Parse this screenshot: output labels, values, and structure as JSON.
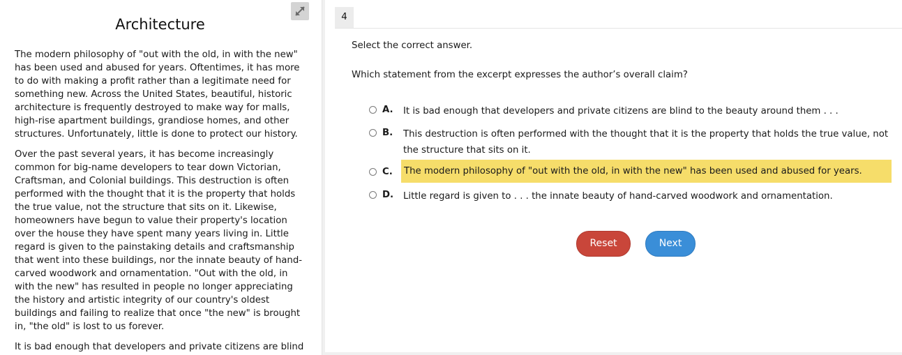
{
  "passage": {
    "title": "Architecture",
    "paragraphs": [
      "The modern philosophy of \"out with the old, in with the new\" has been used and abused for years. Oftentimes, it has more to do with making a profit rather than a legitimate need for something new. Across the United States, beautiful, historic architecture is frequently destroyed to make way for malls, high-rise apartment buildings, grandiose homes, and other structures. Unfortunately, little is done to protect our history.",
      "Over the past several years, it has become increasingly common for big-name developers to tear down Victorian, Craftsman, and Colonial buildings. This destruction is often performed with the thought that it is the property that holds the true value, not the structure that sits on it. Likewise, homeowners have begun to value their property's location over the house they have spent many years living in. Little regard is given to the painstaking details and craftsmanship that went into these buildings, nor the innate beauty of hand-carved woodwork and ornamentation. \"Out with the old, in with the new\" has resulted in people no longer appreciating the history and artistic integrity of our country's oldest buildings and failing to realize that once \"the new\" is brought in, \"the old\" is lost to us forever.",
      "It is bad enough that developers and private citizens are blind"
    ],
    "expand_icon": "expand-arrows-icon"
  },
  "question": {
    "number": "4",
    "instruction": "Select the correct answer.",
    "prompt": "Which statement from the excerpt expresses the author’s overall claim?",
    "options": [
      {
        "letter": "A.",
        "text": "It is bad enough that developers and private citizens are blind to the beauty around them . . ."
      },
      {
        "letter": "B.",
        "text": "This destruction is often performed with the thought that it is the property that holds the true value, not the structure that sits on it."
      },
      {
        "letter": "C.",
        "text": "The modern philosophy of \"out with the old, in with the new\" has been used and abused for years."
      },
      {
        "letter": "D.",
        "text": "Little regard is given to . . . the innate beauty of hand-carved woodwork and ornamentation."
      }
    ],
    "highlight_color": "#f6dd6a"
  },
  "buttons": {
    "reset_label": "Reset",
    "next_label": "Next",
    "reset_color": "#c9463a",
    "next_color": "#3a8ed8"
  }
}
